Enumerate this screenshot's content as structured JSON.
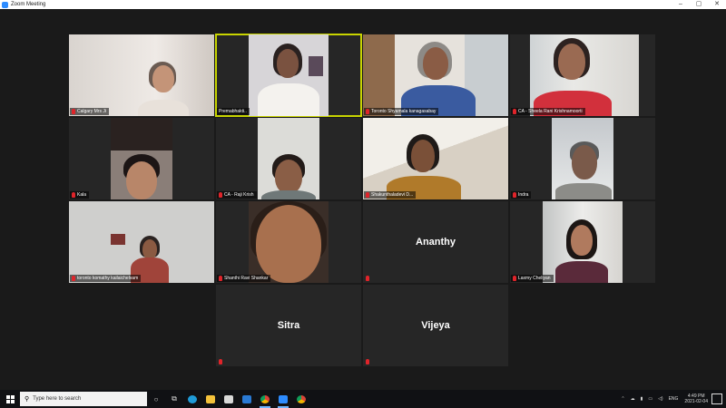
{
  "window": {
    "title": "Zoom Meeting",
    "controls": [
      "–",
      "▢",
      "✕"
    ]
  },
  "participants": [
    {
      "name": "Calgary Mrs Ji"
    },
    {
      "name": "Premabhakti.."
    },
    {
      "name": "Toronto Shyamala kanagasabay"
    },
    {
      "name": "CA - Sheela Rani Krishnamoorti"
    },
    {
      "name": "Kala"
    },
    {
      "name": "CA - Raji Krish"
    },
    {
      "name": "Shakunthaladevi D..."
    },
    {
      "name": "Indra"
    },
    {
      "name": "toronto komathy kailaichelvam"
    },
    {
      "name": "Shanthi Ravi Shankar"
    },
    {
      "name": "Ananthy",
      "display": "Ananthy"
    },
    {
      "name": "Laxmy Cheliyan"
    },
    {
      "name": "Sitra",
      "display": "Sitra"
    },
    {
      "name": "Vijeya",
      "display": "Vijeya"
    }
  ],
  "taskbar": {
    "search_placeholder": "Type here to search",
    "icons": [
      "start-icon",
      "search-icon",
      "cortana-icon",
      "task-view-icon",
      "edge-icon",
      "file-explorer-icon",
      "store-icon",
      "mail-icon",
      "chrome-icon",
      "zoom-icon",
      "chrome-icon"
    ],
    "tray_lang": "ENG",
    "time": "4:49 PM",
    "date": "2021-02-04"
  },
  "colors": {
    "active_border": "#c8d400",
    "mic_muted": "#e0242a",
    "zoom_blue": "#2d8cff"
  }
}
